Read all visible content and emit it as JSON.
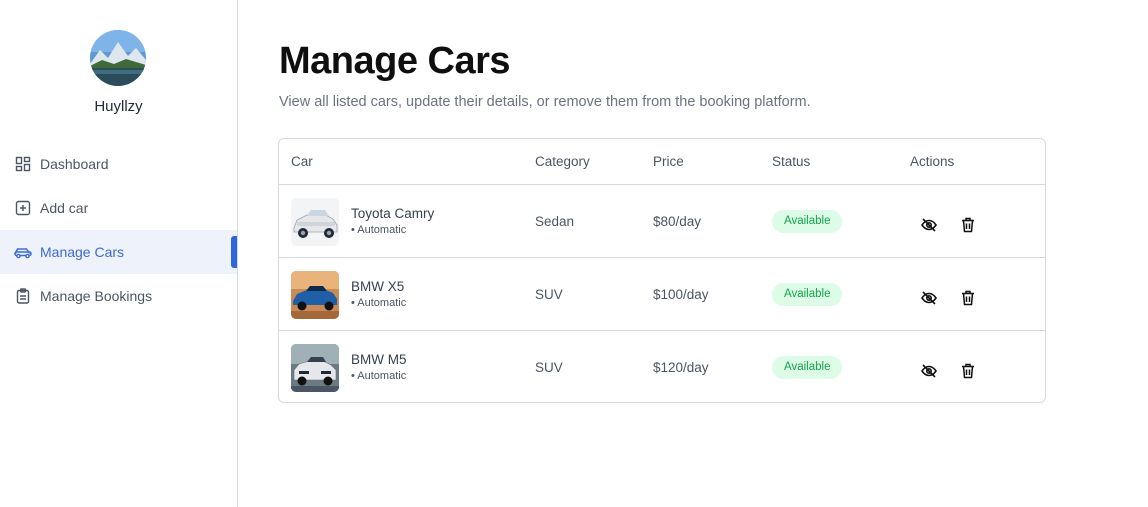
{
  "user": {
    "name": "Huyllzy"
  },
  "nav": [
    {
      "label": "Dashboard",
      "icon": "dashboard-icon"
    },
    {
      "label": "Add car",
      "icon": "plus-square-icon"
    },
    {
      "label": "Manage Cars",
      "icon": "car-icon",
      "active": true
    },
    {
      "label": "Manage Bookings",
      "icon": "clipboard-icon"
    }
  ],
  "page": {
    "title": "Manage Cars",
    "subtitle": "View all listed cars, update their details, or remove them from the booking platform."
  },
  "table": {
    "headers": [
      "Car",
      "Category",
      "Price",
      "Status",
      "Actions"
    ],
    "rows": [
      {
        "name": "Toyota Camry",
        "transmission": "• Automatic",
        "category": "Sedan",
        "price": "$80/day",
        "status": "Available"
      },
      {
        "name": "BMW X5",
        "transmission": "• Automatic",
        "category": "SUV",
        "price": "$100/day",
        "status": "Available"
      },
      {
        "name": "BMW M5",
        "transmission": "• Automatic",
        "category": "SUV",
        "price": "$120/day",
        "status": "Available"
      }
    ]
  },
  "colors": {
    "accent": "#2f66e0",
    "status_available_bg": "#dcfce7",
    "status_available_text": "#16a34a"
  }
}
